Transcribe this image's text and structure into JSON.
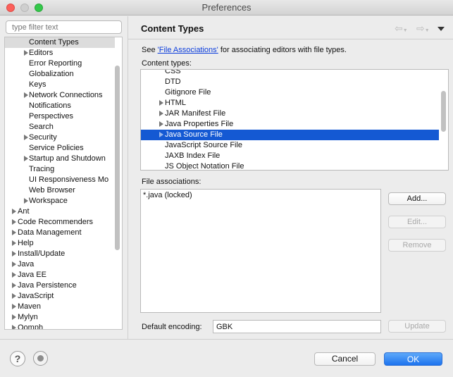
{
  "window": {
    "title": "Preferences"
  },
  "filter": {
    "placeholder": "type filter text"
  },
  "tree": {
    "items": [
      {
        "label": "Content Types",
        "selected": true,
        "expandable": false
      },
      {
        "label": "Editors",
        "expandable": true
      },
      {
        "label": "Error Reporting",
        "expandable": false
      },
      {
        "label": "Globalization",
        "expandable": false
      },
      {
        "label": "Keys",
        "expandable": false
      },
      {
        "label": "Network Connections",
        "expandable": true
      },
      {
        "label": "Notifications",
        "expandable": false
      },
      {
        "label": "Perspectives",
        "expandable": false
      },
      {
        "label": "Search",
        "expandable": false
      },
      {
        "label": "Security",
        "expandable": true
      },
      {
        "label": "Service Policies",
        "expandable": false
      },
      {
        "label": "Startup and Shutdown",
        "expandable": true
      },
      {
        "label": "Tracing",
        "expandable": false
      },
      {
        "label": "UI Responsiveness Mo",
        "expandable": false
      },
      {
        "label": "Web Browser",
        "expandable": false
      },
      {
        "label": "Workspace",
        "expandable": true
      },
      {
        "label": "Ant",
        "expandable": true
      },
      {
        "label": "Code Recommenders",
        "expandable": true
      },
      {
        "label": "Data Management",
        "expandable": true
      },
      {
        "label": "Help",
        "expandable": true
      },
      {
        "label": "Install/Update",
        "expandable": true
      },
      {
        "label": "Java",
        "expandable": true
      },
      {
        "label": "Java EE",
        "expandable": true
      },
      {
        "label": "Java Persistence",
        "expandable": true
      },
      {
        "label": "JavaScript",
        "expandable": true
      },
      {
        "label": "Maven",
        "expandable": true
      },
      {
        "label": "Mylyn",
        "expandable": true
      },
      {
        "label": "Oomph",
        "expandable": true
      }
    ]
  },
  "page": {
    "title": "Content Types",
    "see_prefix": "See ",
    "link_text": "'File Associations'",
    "see_suffix": " for associating editors with file types.",
    "content_types_label": "Content types:",
    "content_types": [
      {
        "label": "CSS",
        "expandable": false
      },
      {
        "label": "DTD",
        "expandable": false
      },
      {
        "label": "Gitignore File",
        "expandable": false
      },
      {
        "label": "HTML",
        "expandable": true
      },
      {
        "label": "JAR Manifest File",
        "expandable": true
      },
      {
        "label": "Java Properties File",
        "expandable": true
      },
      {
        "label": "Java Source File",
        "expandable": true,
        "selected": true
      },
      {
        "label": "JavaScript Source File",
        "expandable": false
      },
      {
        "label": "JAXB Index File",
        "expandable": false
      },
      {
        "label": "JS Object Notation File",
        "expandable": false
      }
    ],
    "file_associations_label": "File associations:",
    "file_associations": [
      "*.java (locked)"
    ],
    "add_label": "Add...",
    "edit_label": "Edit...",
    "remove_label": "Remove",
    "encoding_label": "Default encoding:",
    "encoding_value": "GBK",
    "update_label": "Update"
  },
  "footer": {
    "help_glyph": "?",
    "cancel_label": "Cancel",
    "ok_label": "OK"
  },
  "colors": {
    "selection": "#1459d3",
    "ok_button": "#1d73ee",
    "link": "#0b3ddc"
  },
  "icons": [
    "back-arrow-icon",
    "forward-arrow-icon",
    "view-menu-icon",
    "help-icon",
    "record-macro-icon"
  ]
}
